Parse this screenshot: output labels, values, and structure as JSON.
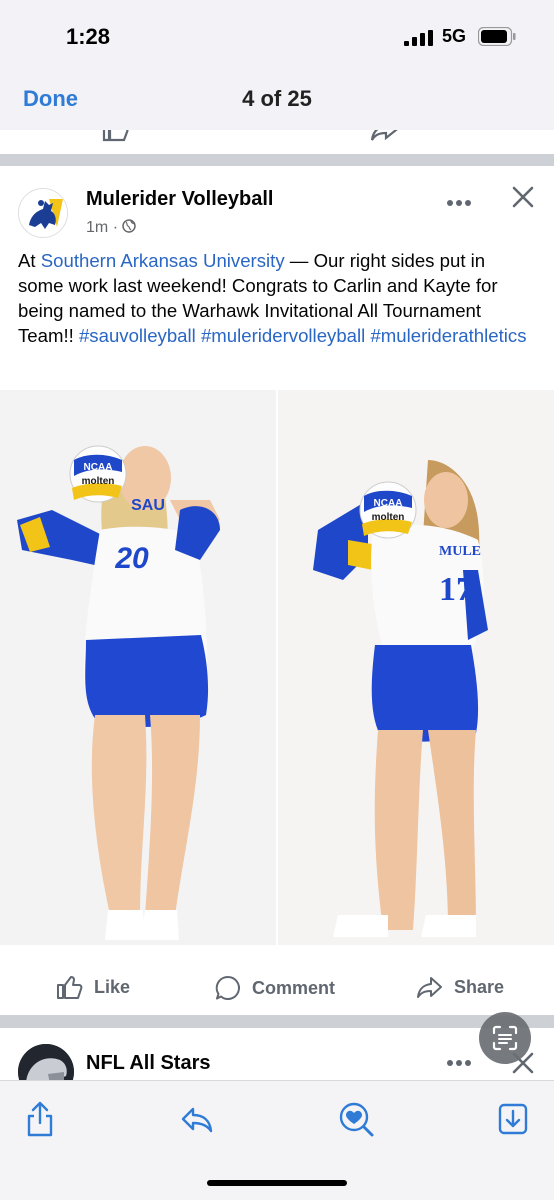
{
  "status": {
    "time": "1:28",
    "network": "5G"
  },
  "nav": {
    "done_label": "Done",
    "counter": "4 of 25"
  },
  "post": {
    "page_name": "Mulerider Volleyball",
    "time": "1m",
    "text_prefix": "At ",
    "link_location": "Southern Arkansas University",
    "text_body": " — Our right sides put in some work last weekend! Congrats to Carlin and Kayte for being named to the Warhawk Invitational All Tournament Team!! ",
    "hashtags": [
      "#sauvolleyball",
      "#muleridervolleyball",
      "#muleriderathletics"
    ],
    "photos": [
      {
        "jersey_number": "20",
        "jersey_text": "SAU",
        "ball_brand": "molten",
        "ball_badge": "NCAA"
      },
      {
        "jersey_number": "17",
        "jersey_text": "MULE",
        "ball_brand": "molten",
        "ball_badge": "NCAA"
      }
    ],
    "actions": {
      "like": "Like",
      "comment": "Comment",
      "share": "Share"
    }
  },
  "next_post": {
    "page_name": "NFL All Stars"
  },
  "colors": {
    "link": "#2a66c4",
    "nav_blue": "#2f7bd6",
    "jersey_blue": "#1f47c9",
    "jersey_yellow": "#f2c418"
  },
  "icons": [
    "signal-icon",
    "battery-icon",
    "more-icon",
    "close-icon",
    "globe-icon",
    "like-icon",
    "comment-icon",
    "share-icon",
    "scan-icon",
    "share-sheet-icon",
    "reply-icon",
    "heart-search-icon",
    "download-icon"
  ]
}
